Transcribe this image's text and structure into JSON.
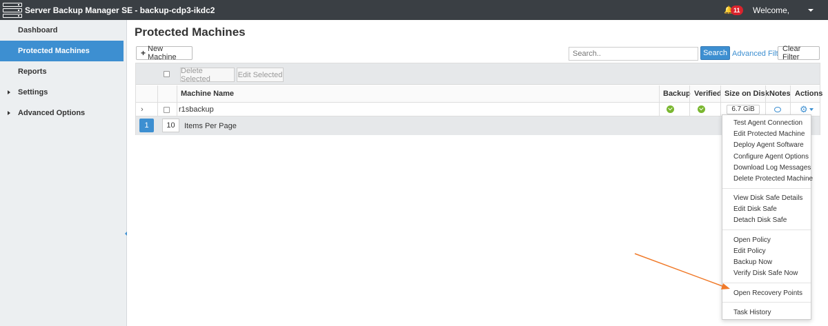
{
  "topbar": {
    "app_title": "Server Backup Manager SE - backup-cdp3-ikdc2",
    "notification_count": "11",
    "welcome_text": "Welcome,"
  },
  "sidebar": {
    "items": [
      {
        "label": "Dashboard"
      },
      {
        "label": "Protected Machines"
      },
      {
        "label": "Reports"
      },
      {
        "label": "Settings"
      },
      {
        "label": "Advanced Options"
      }
    ]
  },
  "main": {
    "title": "Protected Machines",
    "new_machine_label": "New Machine",
    "search_placeholder": "Search..",
    "search_label": "Search",
    "advanced_filter_label": "Advanced Filter",
    "clear_filter_label": "Clear Filter",
    "delete_selected_label": "Delete Selected",
    "edit_selected_label": "Edit Selected"
  },
  "table": {
    "columns": {
      "machine_name": "Machine Name",
      "backup": "Backup",
      "verified": "Verified",
      "size_on_disk": "Size on Disk",
      "notes": "Notes",
      "actions": "Actions"
    },
    "rows": [
      {
        "machine_name": "r1sbackup",
        "size_on_disk": "6.7 GiB"
      }
    ],
    "pagination": {
      "page": "1",
      "items_per_page": "10",
      "items_per_page_label": "Items Per Page"
    }
  },
  "actions_menu": {
    "groups": [
      [
        "Test Agent Connection",
        "Edit Protected Machine",
        "Deploy Agent Software",
        "Configure Agent Options",
        "Download Log Messages",
        "Delete Protected Machine"
      ],
      [
        "View Disk Safe Details",
        "Edit Disk Safe",
        "Detach Disk Safe"
      ],
      [
        "Open Policy",
        "Edit Policy",
        "Backup Now",
        "Verify Disk Safe Now"
      ],
      [
        "Open Recovery Points"
      ],
      [
        "Task History"
      ]
    ]
  },
  "colors": {
    "accent": "#3d8fd1",
    "topbar": "#3a3f44",
    "annotation_arrow": "#f07a2a",
    "status_ok": "#7ab730"
  }
}
